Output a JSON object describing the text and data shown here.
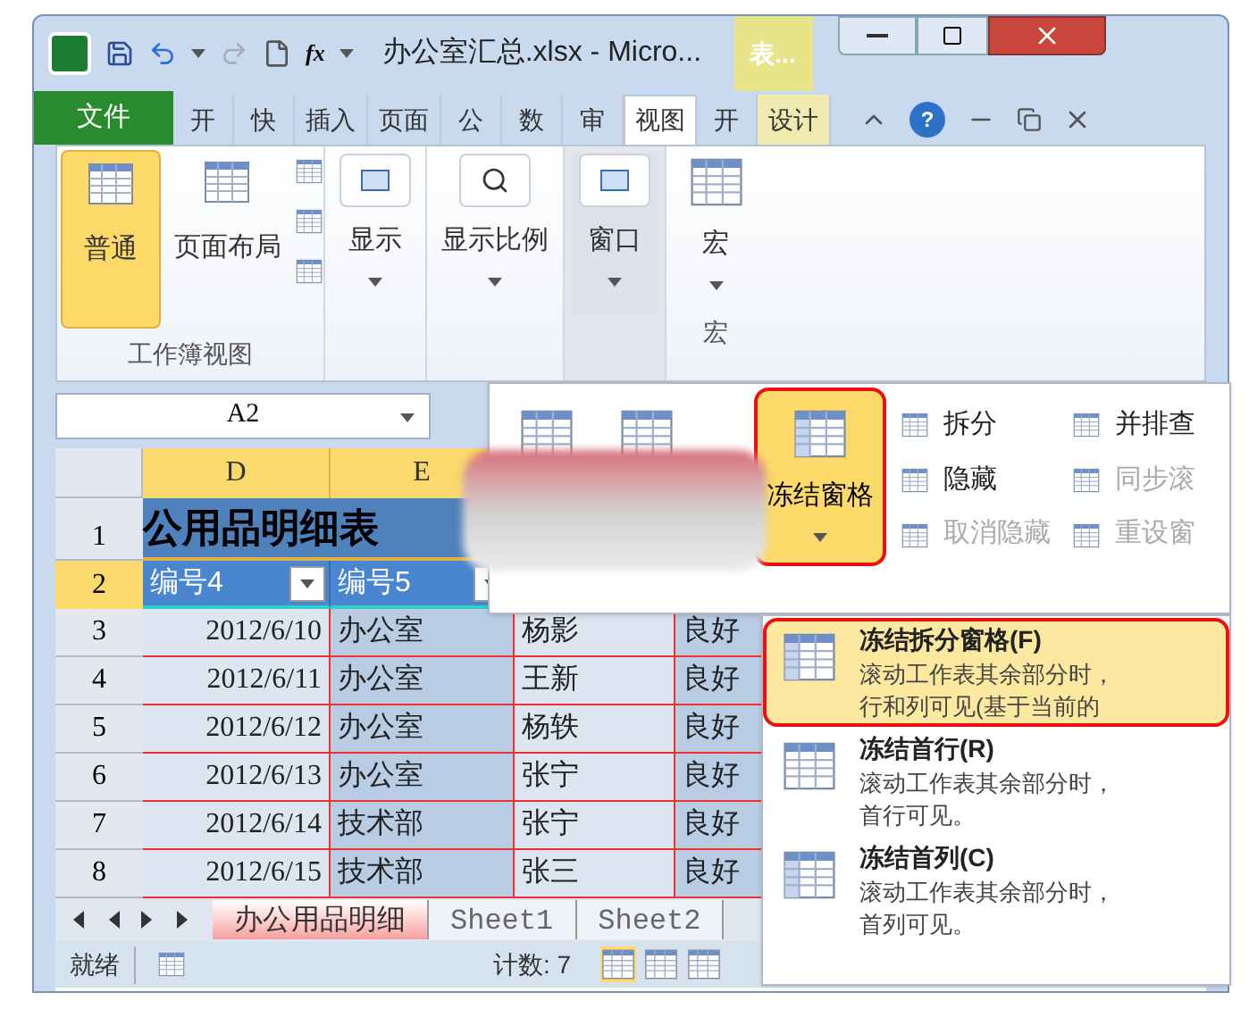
{
  "window": {
    "title": "办公室汇总.xlsx - Micro...",
    "context_tab": "表..."
  },
  "file_tab": "文件",
  "tabs": [
    {
      "label": "开",
      "selected": false,
      "kind": "normal"
    },
    {
      "label": "快",
      "selected": false,
      "kind": "normal"
    },
    {
      "label": "插入",
      "selected": false,
      "kind": "normal"
    },
    {
      "label": "页面",
      "selected": false,
      "kind": "normal"
    },
    {
      "label": "公",
      "selected": false,
      "kind": "normal"
    },
    {
      "label": "数",
      "selected": false,
      "kind": "normal"
    },
    {
      "label": "审",
      "selected": false,
      "kind": "normal"
    },
    {
      "label": "视图",
      "selected": true,
      "kind": "normal"
    },
    {
      "label": "开",
      "selected": false,
      "kind": "normal"
    },
    {
      "label": "设计",
      "selected": false,
      "kind": "contextual"
    }
  ],
  "workbook_views": {
    "label": "工作簿视图",
    "buttons": [
      {
        "label": "普通",
        "selected": true
      },
      {
        "label": "页面布局",
        "selected": false
      }
    ]
  },
  "dropdown_buttons": [
    {
      "label": "显示",
      "pressed": false
    },
    {
      "label": "显示比例",
      "pressed": false
    },
    {
      "label": "窗口",
      "pressed": true
    }
  ],
  "macro_group": {
    "button": "宏",
    "label": "宏"
  },
  "name_box": "A2",
  "columns": [
    "D",
    "E"
  ],
  "function_symbol": "fx",
  "help_symbol": "?",
  "title_row": {
    "row": "1",
    "text": "公用品明细表"
  },
  "header_row": {
    "row": "2",
    "cells": [
      "编号4",
      "编号5"
    ]
  },
  "rows": [
    {
      "row": "3",
      "cells": [
        "2012/6/10",
        "办公室",
        "杨影",
        "良好"
      ]
    },
    {
      "row": "4",
      "cells": [
        "2012/6/11",
        "办公室",
        "王新",
        "良好"
      ]
    },
    {
      "row": "5",
      "cells": [
        "2012/6/12",
        "办公室",
        "杨轶",
        "良好"
      ]
    },
    {
      "row": "6",
      "cells": [
        "2012/6/13",
        "办公室",
        "张宁",
        "良好"
      ]
    },
    {
      "row": "7",
      "cells": [
        "2012/6/14",
        "技术部",
        "张宁",
        "良好"
      ]
    },
    {
      "row": "8",
      "cells": [
        "2012/6/15",
        "技术部",
        "张三",
        "良好"
      ]
    }
  ],
  "sheet_tabs": [
    {
      "label": "办公用品明细",
      "selected": true
    },
    {
      "label": "Sheet1",
      "selected": false
    },
    {
      "label": "Sheet2",
      "selected": false
    }
  ],
  "status_bar": {
    "ready": "就绪",
    "count": "计数: 7"
  },
  "window_menu": {
    "freeze_button": {
      "label": "冻结窗格",
      "highlighted": true
    },
    "items": [
      {
        "label": "拆分",
        "disabled": false
      },
      {
        "label": "隐藏",
        "disabled": false
      },
      {
        "label": "取消隐藏",
        "disabled": true
      },
      {
        "label": "并排查",
        "disabled": false
      },
      {
        "label": "同步滚",
        "disabled": true
      },
      {
        "label": "重设窗",
        "disabled": true
      }
    ]
  },
  "freeze_menu": [
    {
      "title": "冻结拆分窗格(F)",
      "lines": [
        "滚动工作表其余部分时，",
        "行和列可见(基于当前的"
      ],
      "selected": true,
      "highlighted": true
    },
    {
      "title": "冻结首行(R)",
      "lines": [
        "滚动工作表其余部分时，",
        "首行可见。"
      ],
      "selected": false,
      "highlighted": false
    },
    {
      "title": "冻结首列(C)",
      "lines": [
        "滚动工作表其余部分时，",
        "首列可见。"
      ],
      "selected": false,
      "highlighted": false
    }
  ]
}
